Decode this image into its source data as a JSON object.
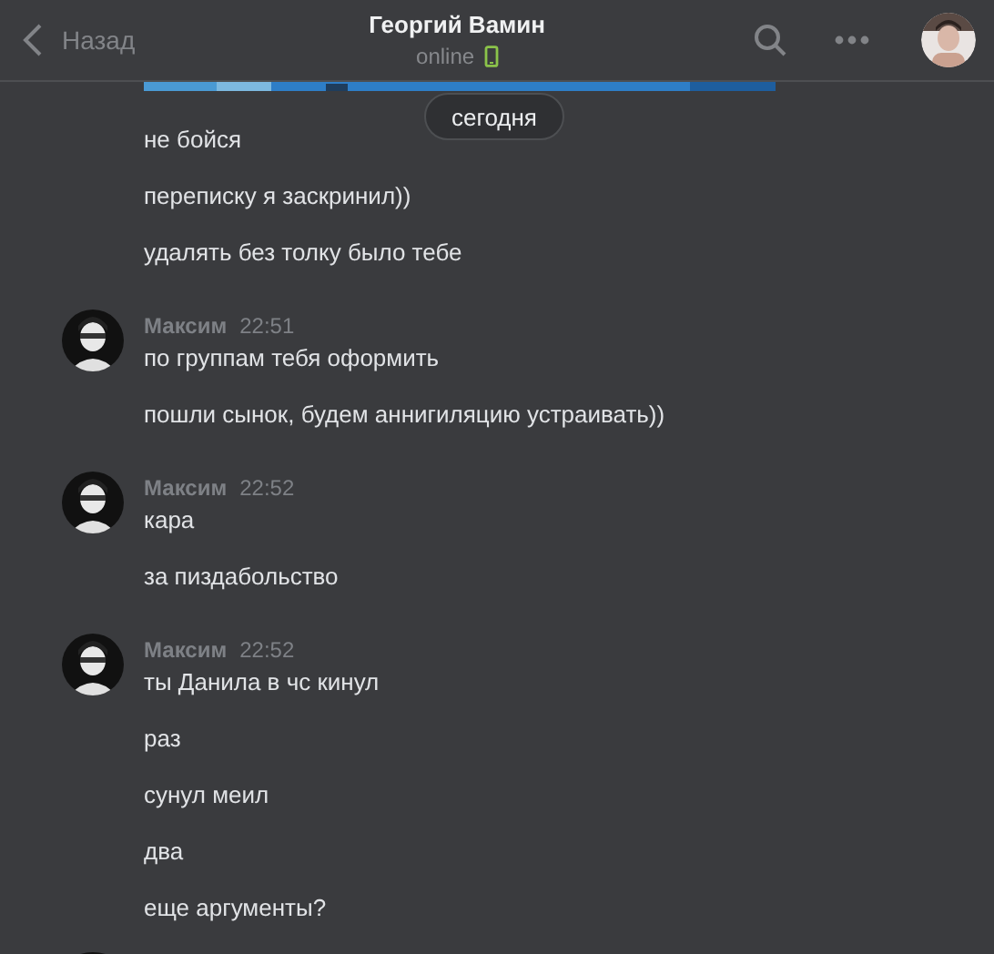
{
  "header": {
    "back_label": "Назад",
    "title": "Георгий Вамин",
    "status": "online",
    "mobile": true
  },
  "date_divider": "сегодня",
  "groups": [
    {
      "messages": [
        "не бойся",
        "переписку я заскринил))",
        "удалять без толку было тебе"
      ]
    },
    {
      "author": "Максим",
      "time": "22:51",
      "messages": [
        "по группам тебя оформить",
        "пошли сынок, будем аннигиляцию устраивать))"
      ]
    },
    {
      "author": "Максим",
      "time": "22:52",
      "messages": [
        "кара",
        "за пиздабольство"
      ]
    },
    {
      "author": "Максим",
      "time": "22:52",
      "messages": [
        "ты Данила в чс кинул",
        "раз",
        "сунул меил",
        "два",
        "еще аргументы?"
      ]
    }
  ]
}
